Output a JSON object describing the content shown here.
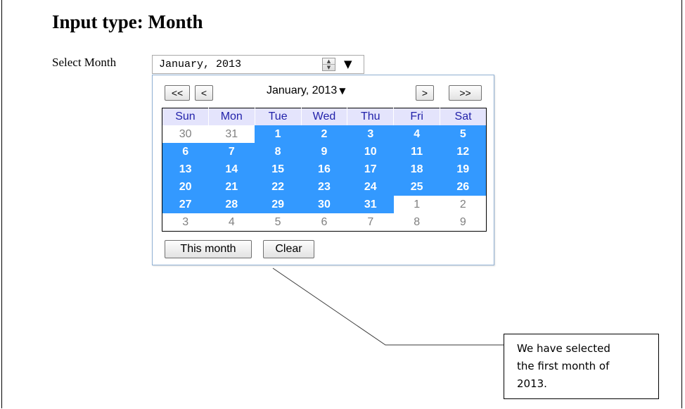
{
  "page": {
    "title": "Input type: Month",
    "field_label": "Select Month"
  },
  "input": {
    "value": "January, 2013",
    "spinner_icon": "spinner-up-down-icon",
    "dropdown_icon": "dropdown-triangle-icon",
    "dropdown_glyph": "▼"
  },
  "picker": {
    "prev_year": "<<",
    "prev_month": "<",
    "month_label": "January, 2013",
    "month_caret": "▼",
    "next_month": ">",
    "next_year": ">>",
    "weekdays": [
      "Sun",
      "Mon",
      "Tue",
      "Wed",
      "Thu",
      "Fri",
      "Sat"
    ],
    "weeks": [
      [
        {
          "d": "30",
          "in": false
        },
        {
          "d": "31",
          "in": false
        },
        {
          "d": "1",
          "in": true
        },
        {
          "d": "2",
          "in": true
        },
        {
          "d": "3",
          "in": true
        },
        {
          "d": "4",
          "in": true
        },
        {
          "d": "5",
          "in": true
        }
      ],
      [
        {
          "d": "6",
          "in": true
        },
        {
          "d": "7",
          "in": true
        },
        {
          "d": "8",
          "in": true
        },
        {
          "d": "9",
          "in": true
        },
        {
          "d": "10",
          "in": true
        },
        {
          "d": "11",
          "in": true
        },
        {
          "d": "12",
          "in": true
        }
      ],
      [
        {
          "d": "13",
          "in": true
        },
        {
          "d": "14",
          "in": true
        },
        {
          "d": "15",
          "in": true
        },
        {
          "d": "16",
          "in": true
        },
        {
          "d": "17",
          "in": true
        },
        {
          "d": "18",
          "in": true
        },
        {
          "d": "19",
          "in": true
        }
      ],
      [
        {
          "d": "20",
          "in": true
        },
        {
          "d": "21",
          "in": true
        },
        {
          "d": "22",
          "in": true
        },
        {
          "d": "23",
          "in": true
        },
        {
          "d": "24",
          "in": true
        },
        {
          "d": "25",
          "in": true
        },
        {
          "d": "26",
          "in": true
        }
      ],
      [
        {
          "d": "27",
          "in": true
        },
        {
          "d": "28",
          "in": true
        },
        {
          "d": "29",
          "in": true
        },
        {
          "d": "30",
          "in": true
        },
        {
          "d": "31",
          "in": true
        },
        {
          "d": "1",
          "in": false
        },
        {
          "d": "2",
          "in": false
        }
      ],
      [
        {
          "d": "3",
          "in": false
        },
        {
          "d": "4",
          "in": false
        },
        {
          "d": "5",
          "in": false
        },
        {
          "d": "6",
          "in": false
        },
        {
          "d": "7",
          "in": false
        },
        {
          "d": "8",
          "in": false
        },
        {
          "d": "9",
          "in": false
        }
      ]
    ],
    "this_month": "This month",
    "clear": "Clear"
  },
  "callout": {
    "lines": [
      "We have selected",
      "the first month of",
      "2013."
    ]
  },
  "colors": {
    "selected_bg": "#3399ff",
    "header_bg": "#e4e4fc",
    "header_text": "#2222aa",
    "other_month_text": "#808080"
  }
}
